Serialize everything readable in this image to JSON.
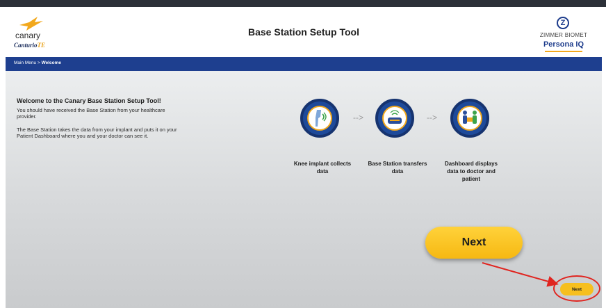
{
  "header": {
    "title": "Base Station Setup Tool",
    "left_logo": {
      "brand": "canary",
      "product_main": "Canturio",
      "product_suffix": "TE"
    },
    "right_logo": {
      "brand": "ZIMMER BIOMET",
      "product_main": "Persona",
      "product_suffix": "IQ"
    }
  },
  "breadcrumb": {
    "parent": "Main Menu",
    "separator": ">",
    "current": "Welcome"
  },
  "welcome": {
    "heading": "Welcome to the Canary Base Station Setup Tool!",
    "paragraph1": "You should have received the Base Station from your healthcare provider.",
    "paragraph2": "The Base Station takes the data from your implant and puts it on your Patient Dashboard where you and your doctor can see it."
  },
  "steps": [
    {
      "label": "Knee implant collects data",
      "icon": "knee-implant-icon"
    },
    {
      "label": "Base Station transfers data",
      "icon": "base-station-icon"
    },
    {
      "label": "Dashboard displays data to doctor and patient",
      "icon": "dashboard-people-icon"
    }
  ],
  "step_arrow": "-->",
  "next_button_zoomed": {
    "label": "Next"
  },
  "next_button": {
    "label": "Next"
  },
  "colors": {
    "nav_blue": "#1e3f8f",
    "accent_yellow": "#f6bf1e",
    "annotation_red": "#e0241f"
  }
}
